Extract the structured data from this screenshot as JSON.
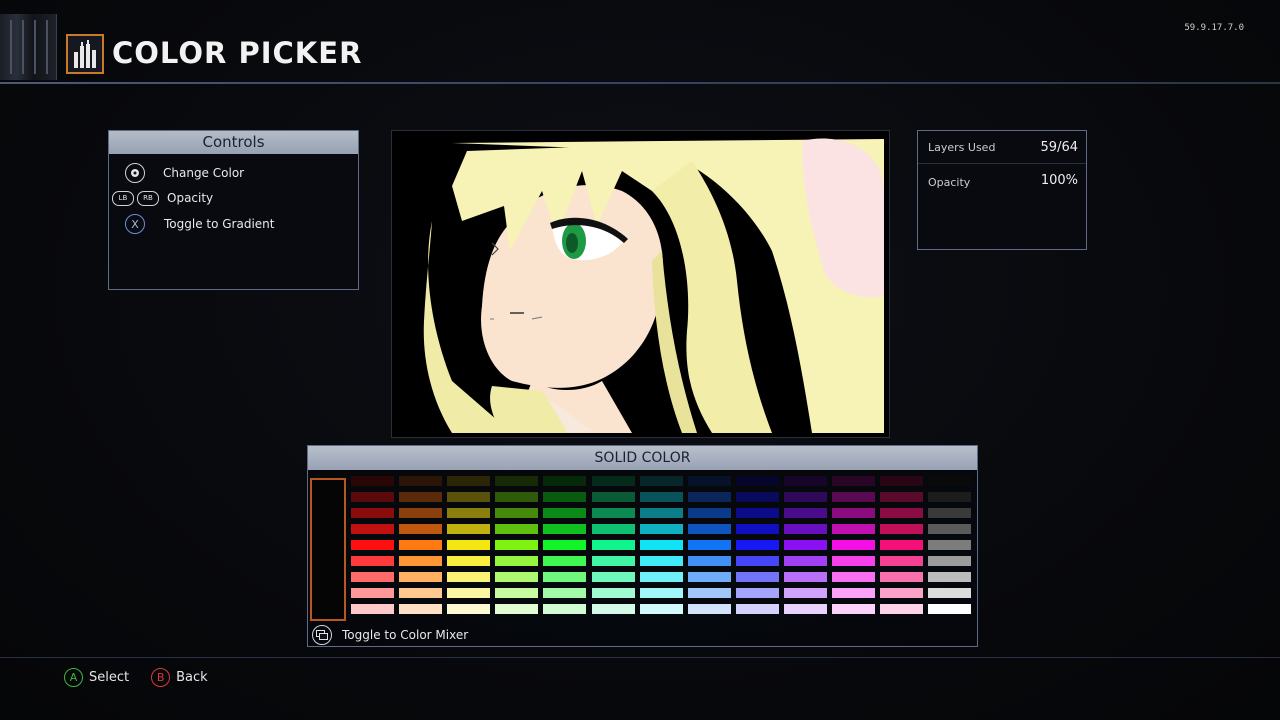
{
  "header": {
    "title": "COLOR PICKER",
    "version": "59.9.17.7.0"
  },
  "controls": {
    "title": "Controls",
    "items": [
      {
        "buttons": [],
        "icon": "right-stick-icon",
        "label": "Change Color"
      },
      {
        "buttons": [
          "LB",
          "RB"
        ],
        "label": "Opacity"
      },
      {
        "buttons": [
          "X"
        ],
        "label": "Toggle to Gradient"
      }
    ]
  },
  "stats": {
    "layers_label": "Layers Used",
    "layers_value": "59/64",
    "opacity_label": "Opacity",
    "opacity_value": "100%"
  },
  "palette": {
    "title": "SOLID COLOR",
    "selected_color": "#050505",
    "toggle_label": "Toggle to Color Mixer",
    "columns": [
      [
        "#2a0606",
        "#5a0a0a",
        "#8a0c0c",
        "#c01010",
        "#ff1010",
        "#ff3a3a",
        "#ff6a6a",
        "#ff9898",
        "#ffc8c8"
      ],
      [
        "#2a1506",
        "#5a2a0a",
        "#8a400c",
        "#c05810",
        "#ff7a10",
        "#ff9636",
        "#ffb060",
        "#ffc890",
        "#ffe0c4"
      ],
      [
        "#2a2606",
        "#5a520a",
        "#8a7e0c",
        "#c0b010",
        "#f4e610",
        "#f8ee40",
        "#faf272",
        "#fcf6a4",
        "#fefad4"
      ],
      [
        "#172a06",
        "#2e5a0a",
        "#468a0c",
        "#60c010",
        "#7cf410",
        "#94f63e",
        "#aef870",
        "#c8faa2",
        "#e4fcd2"
      ],
      [
        "#062a08",
        "#0a5a10",
        "#0c8a18",
        "#10c020",
        "#10f428",
        "#40f650",
        "#70f87c",
        "#a2faa8",
        "#d2fcd4"
      ],
      [
        "#062a1a",
        "#0a5a36",
        "#0c8a52",
        "#10c072",
        "#10f48e",
        "#40f6a4",
        "#70f8bc",
        "#a2fad2",
        "#d2fce8"
      ],
      [
        "#06262a",
        "#0a525a",
        "#0c7e8a",
        "#10b0c0",
        "#10e4f4",
        "#40eaf6",
        "#70f0f8",
        "#a2f6fa",
        "#d2fafc"
      ],
      [
        "#06122a",
        "#0a265a",
        "#0c3a8a",
        "#1054c0",
        "#1074f4",
        "#4090f6",
        "#70acf8",
        "#a2c8fa",
        "#d2e4fc"
      ],
      [
        "#06062a",
        "#0a0a5a",
        "#0c0c8a",
        "#1010c0",
        "#1818f4",
        "#4646f6",
        "#7474f8",
        "#a4a4fa",
        "#d2d2fc"
      ],
      [
        "#16062a",
        "#300a5a",
        "#4a0c8a",
        "#6810c0",
        "#8c10f4",
        "#a240f6",
        "#b870f8",
        "#d0a2fa",
        "#e6d2fc"
      ],
      [
        "#2a0626",
        "#5a0a52",
        "#8a0c7e",
        "#c010b0",
        "#f410e4",
        "#f640ea",
        "#f870f0",
        "#faa2f6",
        "#fcd2fa"
      ],
      [
        "#2a0614",
        "#5a0a2a",
        "#8a0c42",
        "#c0105a",
        "#f41078",
        "#f64092",
        "#f870ac",
        "#faa2c8",
        "#fcd2e4"
      ],
      [
        "#0a0a0a",
        "#1c1c1c",
        "#3a3a3a",
        "#5a5a5a",
        "#7c7c7c",
        "#9c9c9c",
        "#bcbcbc",
        "#dcdcdc",
        "#ffffff"
      ]
    ]
  },
  "footer": {
    "select_button": "A",
    "select_label": "Select",
    "back_button": "B",
    "back_label": "Back"
  },
  "colors": {
    "accent": "#c87a2a",
    "panel_border": "#5e6a86",
    "header_bar": "#98a2b3",
    "button_a": "#3db83d",
    "button_b": "#d93a3a"
  }
}
